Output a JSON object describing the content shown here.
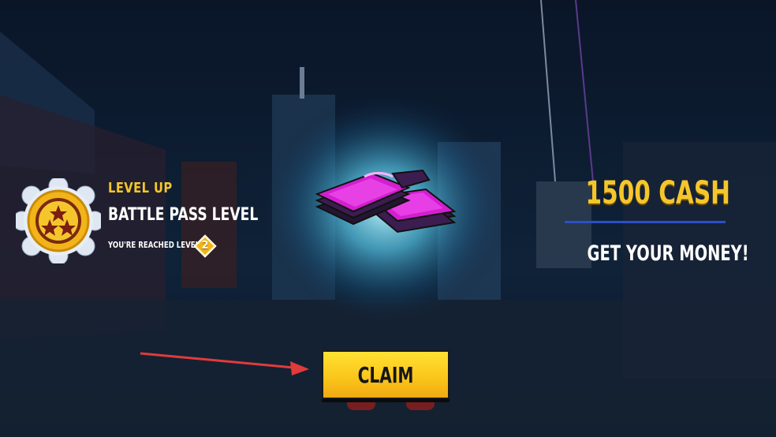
{
  "level_up": {
    "heading": "LEVEL UP",
    "title": "BATTLE PASS LEVEL",
    "reached_text": "YOU'RE REACHED LEVEL",
    "level": "2"
  },
  "reward": {
    "title": "1500 CASH",
    "subtitle": "GET YOUR MONEY!",
    "icon": "cash-cards-icon"
  },
  "claim": {
    "label": "CLAIM"
  },
  "colors": {
    "accent_yellow": "#f5c62c",
    "divider_blue": "#2c4fc7",
    "card_magenta": "#d21fd0",
    "background": "#0b1a30"
  }
}
